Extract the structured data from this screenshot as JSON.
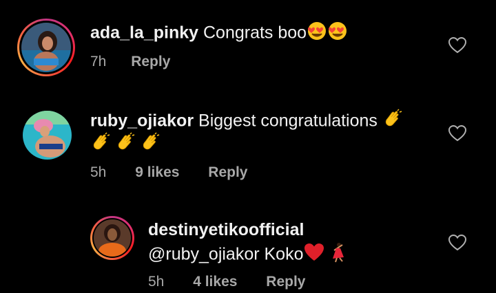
{
  "comments": [
    {
      "username": "ada_la_pinky",
      "text": "Congrats boo",
      "emoji_icons": [
        "heart-eyes-emoji-icon",
        "heart-eyes-emoji-icon"
      ],
      "time": "7h",
      "reply": "Reply",
      "has_story_ring": true
    },
    {
      "username": "ruby_ojiakor",
      "text": "Biggest congratulations",
      "emoji_icons": [
        "clapping-hands-emoji-icon",
        "clapping-hands-emoji-icon",
        "clapping-hands-emoji-icon",
        "clapping-hands-emoji-icon"
      ],
      "time": "5h",
      "likes": "9 likes",
      "reply": "Reply",
      "has_story_ring": false
    },
    {
      "username": "destinyetikoofficial",
      "text": "@ruby_ojiakor Koko",
      "emoji_icons": [
        "red-heart-emoji-icon",
        "dancer-emoji-icon"
      ],
      "time": "5h",
      "likes": "4 likes",
      "reply": "Reply",
      "has_story_ring": true
    }
  ],
  "colors": {
    "background": "#000000",
    "text": "#f2f2f2",
    "meta": "#a8a8a8",
    "heart_outline": "#b0b0b0"
  }
}
